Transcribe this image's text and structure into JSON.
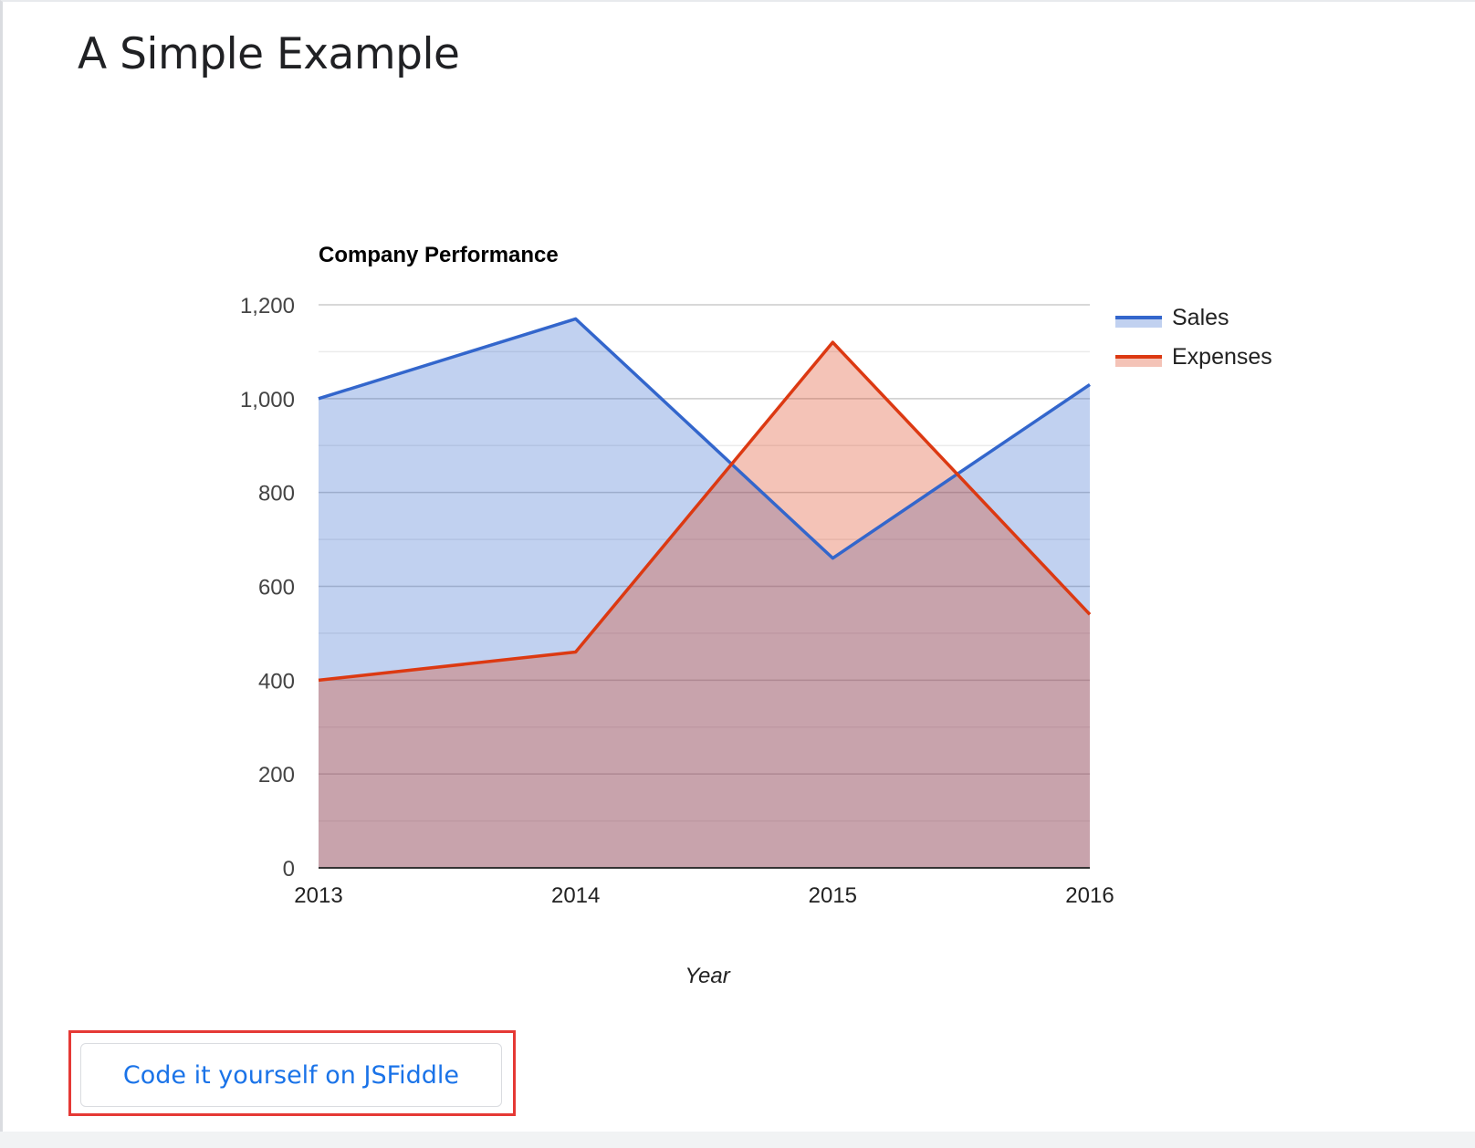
{
  "page": {
    "title": "A Simple Example",
    "button_label": "Code it yourself on JSFiddle"
  },
  "colors": {
    "sales": "#3366cc",
    "expenses": "#dc3912",
    "highlight": "#e53935",
    "link": "#1a73e8"
  },
  "chart_data": {
    "type": "area",
    "title": "Company Performance",
    "xlabel": "Year",
    "ylabel": "",
    "categories": [
      "2013",
      "2014",
      "2015",
      "2016"
    ],
    "series": [
      {
        "name": "Sales",
        "values": [
          1000,
          1170,
          660,
          1030
        ]
      },
      {
        "name": "Expenses",
        "values": [
          400,
          460,
          1120,
          540
        ]
      }
    ],
    "ylim": [
      0,
      1200
    ],
    "yticks": [
      0,
      200,
      400,
      600,
      800,
      1000,
      1200
    ],
    "ytick_labels": [
      "0",
      "200",
      "400",
      "600",
      "800",
      "1,000",
      "1,200"
    ],
    "grid": true,
    "legend": "right"
  }
}
